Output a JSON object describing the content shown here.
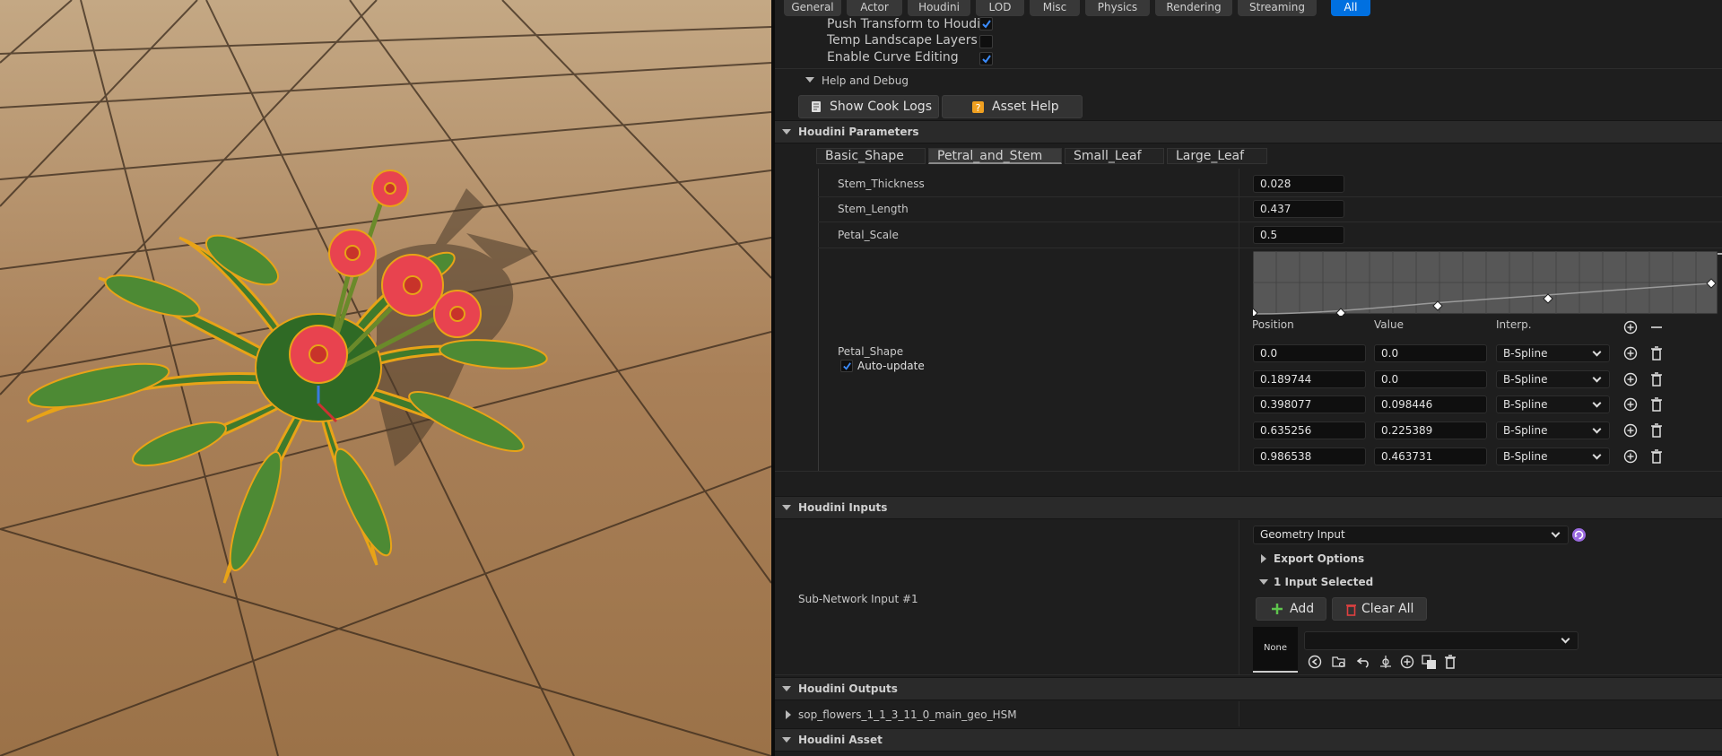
{
  "top_tabs": [
    "General",
    "Actor",
    "Houdini",
    "LOD",
    "Misc",
    "Physics",
    "Rendering",
    "Streaming",
    "All"
  ],
  "active_tab": "All",
  "settings": {
    "push_transform": {
      "label": "Push Transform to Houdini",
      "checked": true
    },
    "temp_landscape": {
      "label": "Temp Landscape Layers",
      "checked": false
    },
    "enable_curve": {
      "label": "Enable Curve Editing",
      "checked": true
    }
  },
  "help_debug": {
    "title": "Help and Debug",
    "show_cook_logs": "Show Cook Logs",
    "asset_help": "Asset Help"
  },
  "houdini_parameters": {
    "title": "Houdini Parameters",
    "tabs": [
      "Basic_Shape",
      "Petral_and_Stem",
      "Small_Leaf",
      "Large_Leaf"
    ],
    "active_tab": "Petral_and_Stem",
    "stem_thickness": {
      "label": "Stem_Thickness",
      "value": "0.028"
    },
    "stem_length": {
      "label": "Stem_Length",
      "value": "0.437"
    },
    "petal_scale": {
      "label": "Petal_Scale",
      "value": "0.5"
    },
    "petal_shape": {
      "label": "Petal_Shape",
      "auto_update": "Auto-update",
      "col_position": "Position",
      "col_value": "Value",
      "col_interp": "Interp.",
      "points": [
        {
          "position": "0.0",
          "value": "0.0",
          "interp": "B-Spline"
        },
        {
          "position": "0.189744",
          "value": "0.0",
          "interp": "B-Spline"
        },
        {
          "position": "0.398077",
          "value": "0.098446",
          "interp": "B-Spline"
        },
        {
          "position": "0.635256",
          "value": "0.225389",
          "interp": "B-Spline"
        },
        {
          "position": "0.986538",
          "value": "0.463731",
          "interp": "B-Spline"
        }
      ]
    }
  },
  "houdini_inputs": {
    "title": "Houdini Inputs",
    "sub_network_label": "Sub-Network Input #1",
    "input_type": "Geometry Input",
    "export_options": "Export Options",
    "input_selected": "1 Input Selected",
    "add": "Add",
    "clear_all": "Clear All",
    "none_thumb": "None"
  },
  "houdini_outputs": {
    "title": "Houdini Outputs",
    "item": "sop_flowers_1_1_3_11_0_main_geo_HSM"
  },
  "houdini_asset": {
    "title": "Houdini Asset"
  },
  "colors": {
    "accent": "#0070e0",
    "panel_bg": "#1e1e1e",
    "leaf_green": "#3f7a2c",
    "leaf_outline": "#e8a317",
    "petal": "#e8434f"
  }
}
